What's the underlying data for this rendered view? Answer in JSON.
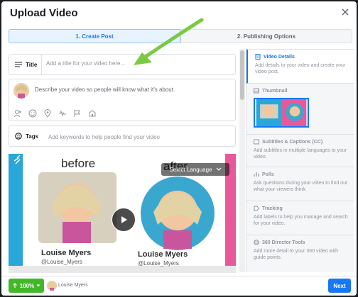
{
  "dialog": {
    "title": "Upload Video",
    "close_icon": "close-icon"
  },
  "steps": [
    {
      "label": "1. Create Post",
      "active": true
    },
    {
      "label": "2. Publishing Options",
      "active": false
    }
  ],
  "form": {
    "title_label": "Title",
    "title_placeholder": "Add a title for your video here...",
    "description_placeholder": "Describe your video so people will know what it's about.",
    "tools": [
      "tag-people-icon",
      "emoji-icon",
      "location-icon",
      "waveform-icon",
      "flag-icon",
      "branded-content-icon"
    ],
    "tags_label": "Tags",
    "tags_placeholder": "Add keywords to help people find your video"
  },
  "video": {
    "before_text": "before",
    "after_text": "after",
    "language_label": "Select Language",
    "name_left": "Louise Myers",
    "handle_left": "@Louise_Myers",
    "name_right": "Louise Myers",
    "handle_right": "@Louise_Myers"
  },
  "sidebar": {
    "items": [
      {
        "title": "Video Details",
        "desc": "Add details to your video and create your video post."
      },
      {
        "title": "Thumbnail",
        "desc": ""
      },
      {
        "title": "Subtitles & Captions (CC)",
        "desc": "Add subtitles in multiple languages to your video."
      },
      {
        "title": "Polls",
        "desc": "Ask questions during your video to find out what your viewers think."
      },
      {
        "title": "Tracking",
        "desc": "Add labels to help you manage and search for your video."
      },
      {
        "title": "360 Director Tools",
        "desc": "Add more detail to your 360 video with guide points."
      }
    ]
  },
  "footer": {
    "upload_progress": "100%",
    "uploader_name": "Louise Myers",
    "next_label": "Next"
  },
  "colors": {
    "accent": "#1877f2",
    "upload_green": "#42b72a",
    "arrow_green": "#7ac943"
  }
}
